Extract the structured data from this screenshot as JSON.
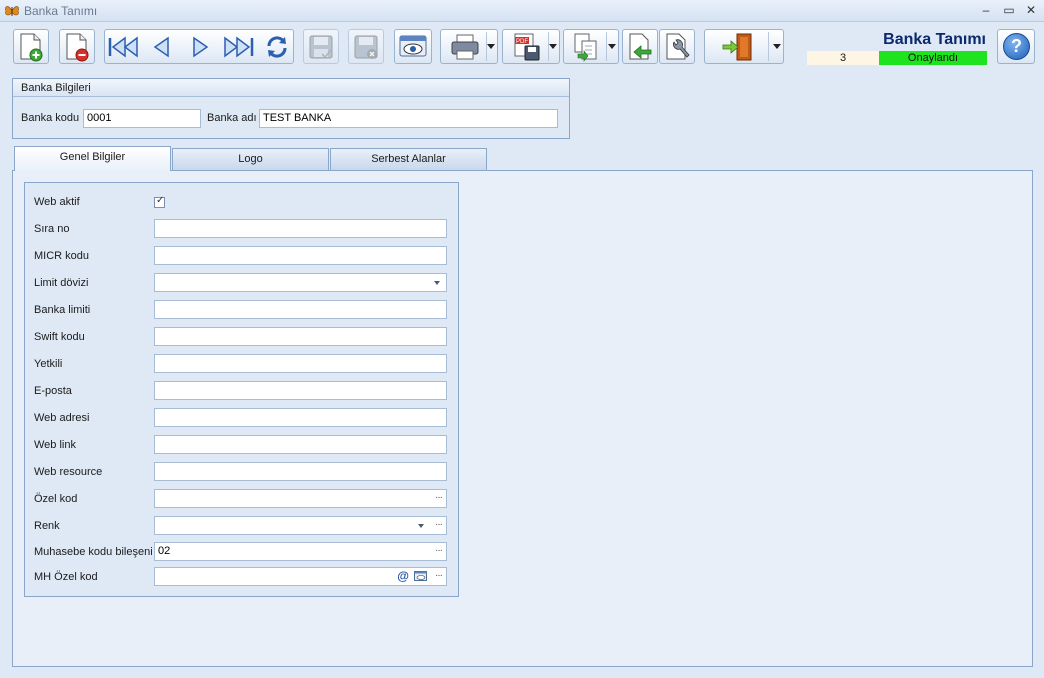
{
  "window": {
    "title": "Banka Tanımı"
  },
  "header": {
    "title": "Banka Tanımı",
    "record_number": "3",
    "status": "Onaylandı",
    "status_color": "#1ee31e"
  },
  "toolbar": {
    "buttons": [
      {
        "name": "new-record",
        "icon": "new-document-plus-icon"
      },
      {
        "name": "delete-record",
        "icon": "document-delete-icon"
      },
      {
        "name": "first-record",
        "icon": "first-record-icon"
      },
      {
        "name": "previous-record",
        "icon": "previous-record-icon"
      },
      {
        "name": "next-record",
        "icon": "next-record-icon"
      },
      {
        "name": "last-record",
        "icon": "last-record-icon"
      },
      {
        "name": "refresh",
        "icon": "refresh-icon"
      },
      {
        "name": "save",
        "icon": "save-icon"
      },
      {
        "name": "save-close",
        "icon": "save-cancel-icon"
      },
      {
        "name": "preview",
        "icon": "preview-eye-icon"
      },
      {
        "name": "print",
        "icon": "printer-icon"
      },
      {
        "name": "export-pdf",
        "icon": "pdf-save-icon"
      },
      {
        "name": "copy",
        "icon": "copy-document-icon"
      },
      {
        "name": "import",
        "icon": "import-document-icon"
      },
      {
        "name": "tools",
        "icon": "wrench-document-icon"
      },
      {
        "name": "exit",
        "icon": "exit-door-icon"
      }
    ]
  },
  "bank_info": {
    "title": "Banka Bilgileri",
    "code_label": "Banka kodu",
    "code_value": "0001",
    "name_label": "Banka adı",
    "name_value": "TEST BANKA"
  },
  "tabs": [
    {
      "label": "Genel Bilgiler",
      "active": true
    },
    {
      "label": "Logo",
      "active": false
    },
    {
      "label": "Serbest Alanlar",
      "active": false
    }
  ],
  "general": {
    "web_active_label": "Web aktif",
    "web_active_checked": true,
    "fields": [
      {
        "label": "Sıra no",
        "value": "",
        "type": "text"
      },
      {
        "label": "MICR kodu",
        "value": "",
        "type": "text"
      },
      {
        "label": "Limit dövizi",
        "value": "",
        "type": "combo"
      },
      {
        "label": "Banka limiti",
        "value": "",
        "type": "text"
      },
      {
        "label": "Swift kodu",
        "value": "",
        "type": "text"
      },
      {
        "label": "Yetkili",
        "value": "",
        "type": "text"
      },
      {
        "label": "E-posta",
        "value": "",
        "type": "text"
      },
      {
        "label": "Web adresi",
        "value": "",
        "type": "text"
      },
      {
        "label": "Web link",
        "value": "",
        "type": "text"
      },
      {
        "label": "Web resource",
        "value": "",
        "type": "text"
      },
      {
        "label": "Özel kod",
        "value": "",
        "type": "ellipsis"
      },
      {
        "label": "Renk",
        "value": "",
        "type": "combo-ellipsis"
      },
      {
        "label": "Muhasebe kodu bileşeni",
        "value": "02",
        "type": "ellipsis"
      },
      {
        "label": "MH Özel kod",
        "value": "",
        "type": "special"
      }
    ]
  }
}
